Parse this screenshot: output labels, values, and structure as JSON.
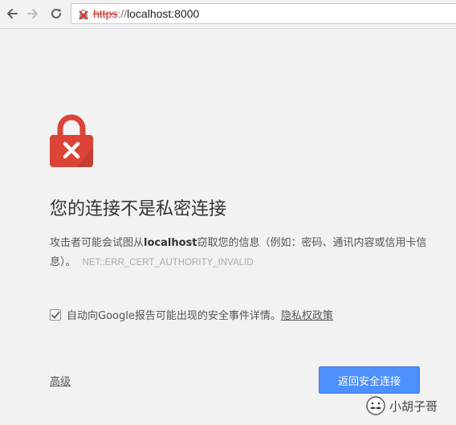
{
  "browser": {
    "url_scheme": "https",
    "url_separator": "://",
    "url_host": "localhost:8000"
  },
  "interstitial": {
    "title": "您的连接不是私密连接",
    "body_prefix": "攻击者可能会试图从",
    "body_host": "localhost",
    "body_suffix": "窃取您的信息（例如：密码、通讯内容或信用卡信息）。",
    "error_code": "NET::ERR_CERT_AUTHORITY_INVALID",
    "report_label": "自动向Google报告可能出现的安全事件详情。",
    "report_checked": true,
    "privacy_link": "隐私权政策",
    "advanced_link": "高级",
    "back_button": "返回安全连接",
    "lock_color": "#db4437",
    "button_color": "#4d90fe"
  },
  "watermark": {
    "text": "小胡子哥"
  }
}
